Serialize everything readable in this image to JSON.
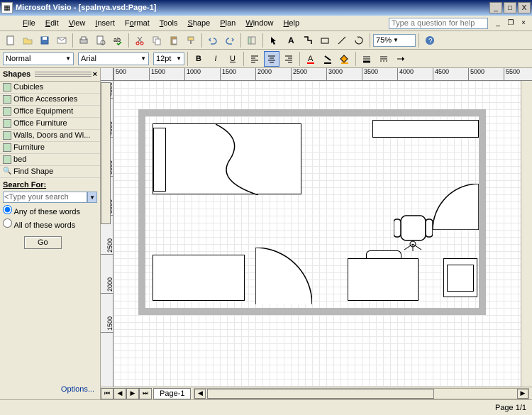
{
  "title": {
    "app": "Microsoft Visio",
    "doc": "[spalnya.vsd:Page-1]"
  },
  "menus": {
    "file": "File",
    "edit": "Edit",
    "view": "View",
    "insert": "Insert",
    "format": "Format",
    "tools": "Tools",
    "shape": "Shape",
    "plan": "Plan",
    "window": "Window",
    "help": "Help"
  },
  "helpPlaceholder": "Type a question for help",
  "style": {
    "name": "Normal",
    "font": "Arial",
    "size": "12pt"
  },
  "zoom": "75%",
  "shapes": {
    "title": "Shapes",
    "stencils": [
      "Cubicles",
      "Office Accessories",
      "Office Equipment",
      "Office Furniture",
      "Walls, Doors and Wi...",
      "Furniture",
      "bed",
      "Find Shape"
    ],
    "searchLabel": "Search For:",
    "searchPlaceholder": "<Type your search",
    "radioAny": "Any of these words",
    "radioAll": "All of these words",
    "goBtn": "Go",
    "options": "Options..."
  },
  "rulerH": [
    "500",
    "1500",
    "1000",
    "1500",
    "2000",
    "2500",
    "3000",
    "3500",
    "4000",
    "4500",
    "5000",
    "5500"
  ],
  "rulerV": [
    "4500",
    "4000",
    "3500",
    "3000",
    "2500",
    "2000",
    "1500"
  ],
  "pageTab": "Page-1",
  "status": {
    "page": "Page 1/1"
  }
}
